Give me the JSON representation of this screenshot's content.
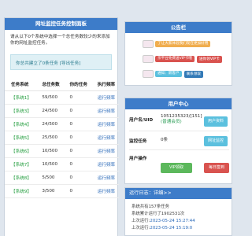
{
  "left_panel": {
    "title": "网址监控任务控制面板",
    "intro": "请从以下0个系统中选择一个总任务数较少的来添加你的网址监控任务。",
    "notice": "你总共建立了0条任务",
    "notice_link": "[导出任务]",
    "columns": [
      "任务系统",
      "总任务数",
      "你的任务",
      "执行频率"
    ],
    "rows": [
      {
        "system": "【系统1】",
        "total": "59/500",
        "mine": "0",
        "freq": "运行频率"
      },
      {
        "system": "【系统3】",
        "total": "24/500",
        "mine": "0",
        "freq": "运行频率"
      },
      {
        "system": "【系统4】",
        "total": "24/500",
        "mine": "0",
        "freq": "运行频率"
      },
      {
        "system": "【系统5】",
        "total": "25/500",
        "mine": "0",
        "freq": "运行频率"
      },
      {
        "system": "【系统6】",
        "total": "10/500",
        "mine": "0",
        "freq": "运行频率"
      },
      {
        "system": "【系统7】",
        "total": "10/500",
        "mine": "0",
        "freq": "运行频率"
      },
      {
        "system": "【系统8】",
        "total": "5/500",
        "mine": "0",
        "freq": "运行频率"
      },
      {
        "system": "【系统9】",
        "total": "3/500",
        "mine": "0",
        "freq": "运行频率"
      }
    ]
  },
  "announcement": {
    "title": "公告栏",
    "items": [
      {
        "tag": "了让大家体验我们现在更加好用",
        "tag_color": "#f0ad4e",
        "button": ""
      },
      {
        "tag": "亲平台免费送VIP卡哦",
        "tag_color": "#d9534f",
        "button": "送你领VIP卡"
      },
      {
        "tag": "通知：新客户",
        "tag_color": "#5bc0de",
        "button": "联系领取"
      }
    ]
  },
  "user_center": {
    "title": "用户中心",
    "uid_label": "用户名/UID",
    "uid_value": "1051235323/[151]",
    "level": "(普通会员)",
    "profile_button": "用户资料",
    "task_label": "监控任务",
    "task_value": "0条",
    "monitor_button": "网址监控",
    "op_label": "用户操作",
    "vip_button": "VIP领取",
    "signin_button": "每日签到"
  },
  "run_log": {
    "title": "运行日志：详细>>",
    "lines": [
      {
        "text": "系统共有157条任务"
      },
      {
        "text": "系统累计运行了1902531次"
      },
      {
        "text": "上次运行:",
        "time": "2023-05-24 15:27:44"
      },
      {
        "text": "上次运行:",
        "time": "2023-05-24 15:19:0"
      }
    ]
  }
}
